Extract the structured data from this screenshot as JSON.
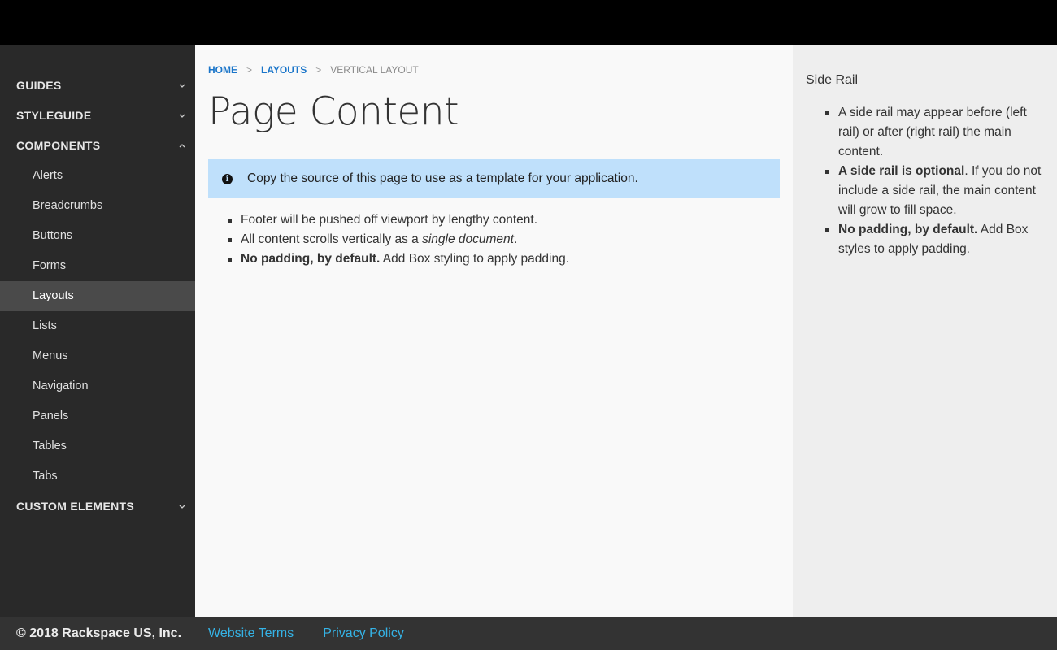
{
  "sidebar": {
    "sections": [
      {
        "label": "GUIDES",
        "icon": "chevron-down-icon"
      },
      {
        "label": "STYLEGUIDE",
        "icon": "chevron-down-icon"
      },
      {
        "label": "COMPONENTS",
        "icon": "chevron-up-icon"
      },
      {
        "label": "CUSTOM ELEMENTS",
        "icon": "chevron-down-icon"
      }
    ],
    "components_items": [
      "Alerts",
      "Breadcrumbs",
      "Buttons",
      "Forms",
      "Layouts",
      "Lists",
      "Menus",
      "Navigation",
      "Panels",
      "Tables",
      "Tabs"
    ],
    "active_item": "Layouts"
  },
  "breadcrumb": {
    "home": "HOME",
    "layouts": "LAYOUTS",
    "current": "VERTICAL LAYOUT",
    "separator": ">"
  },
  "main": {
    "title": "Page Content",
    "alert": {
      "icon": "info-icon",
      "text": "Copy the source of this page to use as a template for your application."
    },
    "list": [
      {
        "text": "Footer will be pushed off viewport by lengthy content."
      },
      {
        "pre": "All content scrolls vertically as a ",
        "em": "single document",
        "post": "."
      },
      {
        "strong": "No padding, by default.",
        "post": " Add Box styling to apply padding."
      }
    ]
  },
  "rail": {
    "title": "Side Rail",
    "list": [
      {
        "text": "A side rail may appear before (left rail) or after (right rail) the main content."
      },
      {
        "strong": "A side rail is optional",
        "post": ". If you do not include a side rail, the main content will grow to fill space."
      },
      {
        "strong": "No padding, by default.",
        "post": " Add Box styles to apply padding."
      }
    ]
  },
  "footer": {
    "copyright": "© 2018 Rackspace US, Inc.",
    "terms": "Website Terms",
    "privacy": "Privacy Policy"
  },
  "colors": {
    "sidebar_bg": "#292929",
    "active_item_bg": "#4a4a4a",
    "link_blue": "#1a75c9",
    "alert_bg": "#bfe0fb",
    "footer_link": "#35b3e6"
  }
}
